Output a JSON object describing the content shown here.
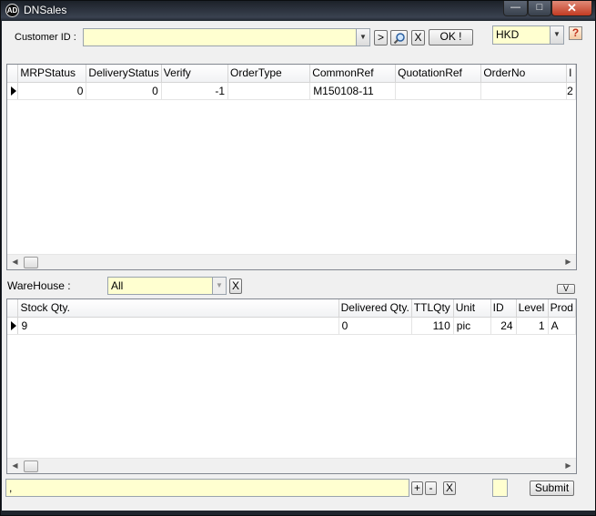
{
  "window": {
    "title": "DNSales",
    "app_icon_text": "AD",
    "minimize_icon": "minimize-icon",
    "maximize_icon": "maximize-icon",
    "close_icon": "close-icon"
  },
  "header": {
    "customer_label": "Customer ID :",
    "customer_value": "",
    "next_label": ">",
    "search_icon": "magnifier-icon",
    "clear_label": "X",
    "ok_label": "OK !",
    "currency": "HKD",
    "help_label": "?"
  },
  "orders_grid": {
    "columns": [
      "MRPStatus",
      "DeliveryStatus",
      "Verify",
      "OrderType",
      "CommonRef",
      "QuotationRef",
      "OrderNo",
      "I"
    ],
    "rows": [
      [
        "0",
        "0",
        "-1",
        "",
        "M150108-11",
        "",
        "",
        "2"
      ]
    ]
  },
  "warehouse": {
    "label": "WareHouse :",
    "value": "All",
    "clear_label": "X",
    "toggle_label": "V"
  },
  "items_grid": {
    "columns": [
      "Stock Qty.",
      "Delivered Qty.",
      "TTLQty",
      "Unit",
      "ID",
      "Level",
      "Prod"
    ],
    "rows": [
      [
        "9",
        "0",
        "110",
        "pic",
        "24",
        "1",
        "A"
      ]
    ]
  },
  "footer": {
    "input_value": ",",
    "plus_label": "+",
    "minus_label": "-",
    "clear_label": "X",
    "submit_label": "Submit"
  }
}
